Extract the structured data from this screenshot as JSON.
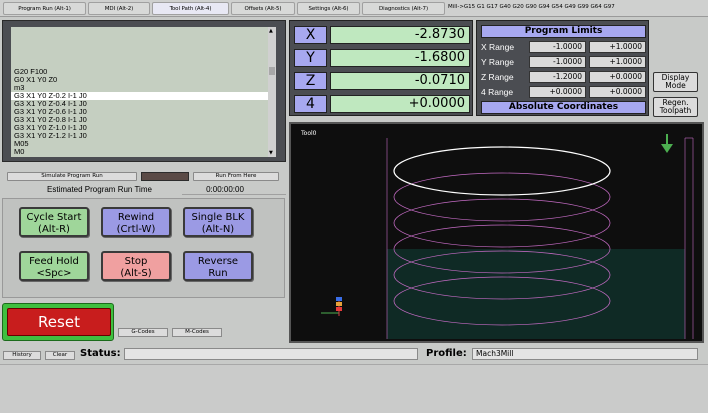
{
  "tabs": [
    {
      "label": "Program Run (Alt-1)",
      "active": false
    },
    {
      "label": "MDI (Alt-2)",
      "active": false
    },
    {
      "label": "Tool Path (Alt-4)",
      "active": true
    },
    {
      "label": "Offsets (Alt-5)",
      "active": false
    },
    {
      "label": "Settings (Alt-6)",
      "active": false
    },
    {
      "label": "Diagnostics (Alt-7)",
      "active": false
    }
  ],
  "active_gcodes": "Mill->G15  G1 G17 G40 G20 G90 G94 G54 G49 G99 G64 G97",
  "gcode_lines": [
    "G20 F100",
    "G0 X1 Y0 Z0",
    "m3",
    "G3 X1 Y0 Z-0.2 I-1 J0",
    "G3 X1 Y0 Z-0.4 I-1 J0",
    "G3 X1 Y0 Z-0.6 I-1 J0",
    "G3 X1 Y0 Z-0.8 I-1 J0",
    "G3 X1 Y0 Z-1.0 I-1 J0",
    "G3 X1 Y0 Z-1.2 I-1 J0",
    "M05",
    "M0"
  ],
  "gcode_highlight_index": 3,
  "simulate": {
    "simulate_label": "Simulate Program Run",
    "run_from_here_label": "Run From Here",
    "estimated_label": "Estimated Program Run Time",
    "estimated_value": "0:00:00:00"
  },
  "buttons": {
    "cycle_start": "Cycle Start\n(Alt-R)",
    "rewind": "Rewind\n(Crtl-W)",
    "single_blk": "Single BLK\n(Alt-N)",
    "feed_hold": "Feed Hold\n<Spc>",
    "stop": "Stop\n(Alt-S)",
    "reverse_run": "Reverse\nRun",
    "reset": "Reset",
    "gcodes": "G-Codes",
    "mcodes": "M-Codes",
    "history": "History",
    "clear": "Clear"
  },
  "dro": [
    {
      "axis": "X",
      "value": "-2.8730"
    },
    {
      "axis": "Y",
      "value": "-1.6800"
    },
    {
      "axis": "Z",
      "value": "-0.0710"
    },
    {
      "axis": "4",
      "value": "+0.0000"
    }
  ],
  "limits": {
    "title": "Program Limits",
    "footer": "Absolute Coordinates",
    "rows": [
      {
        "label": "X Range",
        "min": "-1.0000",
        "max": "+1.0000"
      },
      {
        "label": "Y Range",
        "min": "-1.0000",
        "max": "+1.0000"
      },
      {
        "label": "Z Range",
        "min": "-1.2000",
        "max": "+0.0000"
      },
      {
        "label": "4 Range",
        "min": "+0.0000",
        "max": "+0.0000"
      }
    ]
  },
  "side_buttons": {
    "display_mode": "Display\nMode",
    "regen_toolpath": "Regen.\nToolpath"
  },
  "toolpath": {
    "label": "Tool0",
    "path_color": "#c46bc4",
    "top_color": "#ffffff",
    "background": "#0e0e0e"
  },
  "status": {
    "status_label": "Status:",
    "status_value": "",
    "profile_label": "Profile:",
    "profile_value": "Mach3Mill"
  }
}
